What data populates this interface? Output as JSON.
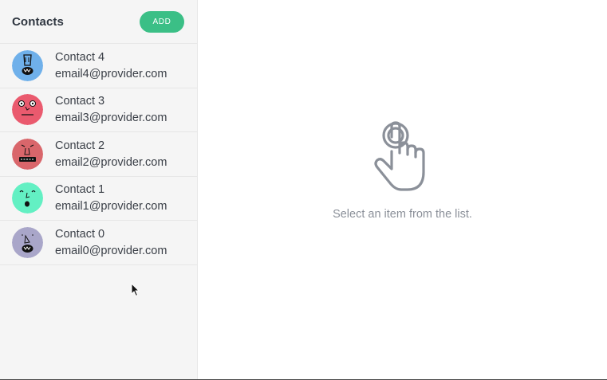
{
  "sidebar": {
    "title": "Contacts",
    "add_label": "ADD",
    "contacts": [
      {
        "name": "Contact 4",
        "email": "email4@provider.com",
        "avatar_color": "#6fb0ea"
      },
      {
        "name": "Contact 3",
        "email": "email3@provider.com",
        "avatar_color": "#ea5a6e"
      },
      {
        "name": "Contact 2",
        "email": "email2@provider.com",
        "avatar_color": "#d9666b"
      },
      {
        "name": "Contact 1",
        "email": "email1@provider.com",
        "avatar_color": "#63f0c3"
      },
      {
        "name": "Contact 0",
        "email": "email0@provider.com",
        "avatar_color": "#a9a6c9"
      }
    ]
  },
  "main": {
    "empty_message": "Select an item from the list.",
    "empty_icon": "pointing-hand-icon"
  },
  "colors": {
    "accent": "#3bbf86",
    "text": "#3a3f47",
    "muted": "#8b9099"
  }
}
